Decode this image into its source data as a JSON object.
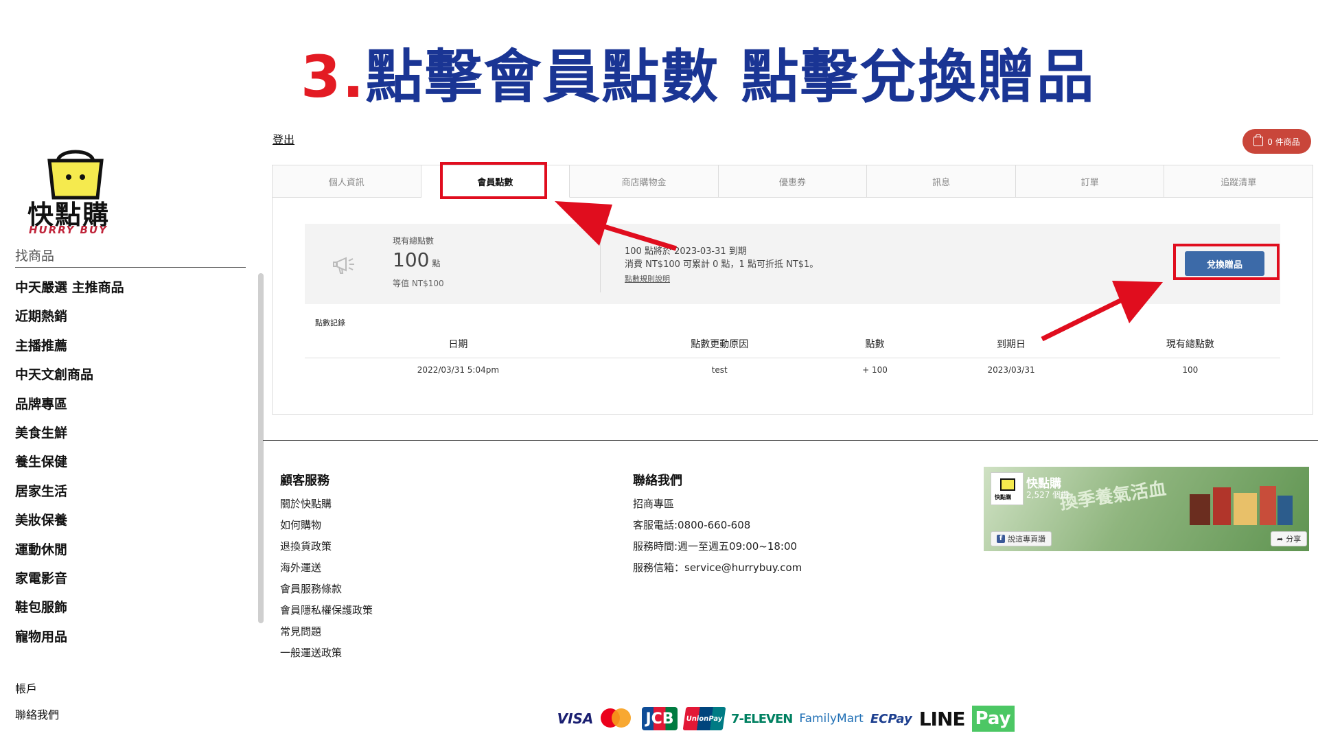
{
  "tutorial": {
    "step_number": "3.",
    "heading": "點擊會員點數 點擊兌換贈品"
  },
  "brand": {
    "name_cn": "快點購",
    "name_en": "HURRY BUY"
  },
  "sidebar": {
    "search_label": "找商品",
    "categories": [
      "中天嚴選 主推商品",
      "近期熱銷",
      "主播推薦",
      "中天文創商品",
      "品牌專區",
      "美食生鮮",
      "養生保健",
      "居家生活",
      "美妝保養",
      "運動休閒",
      "家電影音",
      "鞋包服飾",
      "寵物用品"
    ],
    "account": "帳戶",
    "contact": "聯絡我們"
  },
  "topbar": {
    "logout": "登出",
    "cart": "0 件商品"
  },
  "tabs": [
    {
      "label": "個人資訊",
      "active": false
    },
    {
      "label": "會員點數",
      "active": true
    },
    {
      "label": "商店購物金",
      "active": false
    },
    {
      "label": "優惠券",
      "active": false
    },
    {
      "label": "訊息",
      "active": false
    },
    {
      "label": "訂單",
      "active": false
    },
    {
      "label": "追蹤清單",
      "active": false
    }
  ],
  "points": {
    "total_label": "現有總點數",
    "total_value": "100",
    "unit": "點",
    "equivalent": "等值 NT$100",
    "expiry_line": "100 點將於 2023-03-31 到期",
    "earn_rule": "消費 NT$100 可累計 0 點，1 點可折抵 NT$1。",
    "rule_link": "點數規則說明",
    "redeem_button": "兌換贈品"
  },
  "records": {
    "title": "點數記錄",
    "headers": [
      "日期",
      "點數更動原因",
      "點數",
      "到期日",
      "現有總點數"
    ],
    "rows": [
      [
        "2022/03/31 5:04pm",
        "test",
        "+ 100",
        "2023/03/31",
        "100"
      ]
    ]
  },
  "footer": {
    "customer_service": {
      "title": "顧客服務",
      "links": [
        "關於快點購",
        "如何購物",
        "退換貨政策",
        "海外運送",
        "會員服務條款",
        "會員隱私權保護政策",
        "常見問題",
        "一般運送政策"
      ]
    },
    "contact": {
      "title": "聯絡我們",
      "lines": [
        "招商專區",
        "客服電話:0800-660-608",
        "服務時間:週一至週五09:00~18:00",
        "服務信箱：service@hurrybuy.com"
      ]
    },
    "facebook": {
      "page_name": "快點購",
      "likes": "2,527 個讚",
      "promo": "換季養氣活血",
      "like_button": "說這專頁讚",
      "share_button": "分享"
    },
    "payments": [
      "VISA",
      "mastercard",
      "JCB",
      "UnionPay",
      "7-ELEVEN",
      "FamilyMart",
      "ECPay",
      "LINE",
      "Pay"
    ]
  },
  "colors": {
    "step_number": "#e31b23",
    "heading": "#1a3594",
    "annotation": "#e00d1e",
    "redeem_button": "#3c6aa8",
    "cart_pill": "#c9463a"
  }
}
